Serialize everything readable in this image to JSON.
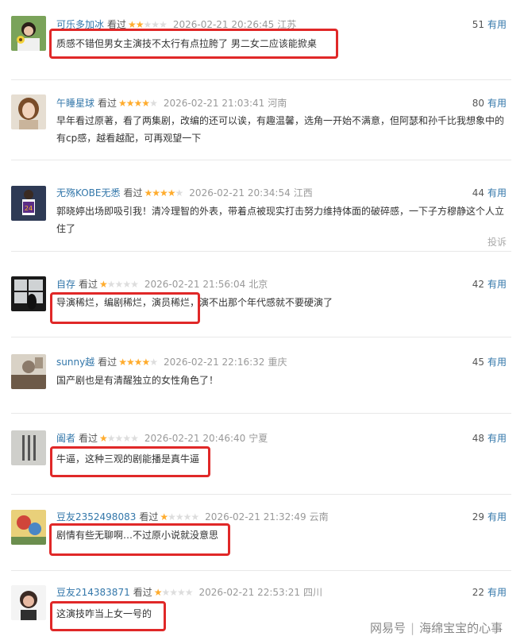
{
  "comments": [
    {
      "user": "可乐多加冰",
      "status": "看过",
      "stars": 2,
      "time": "2026-02-21 20:26:45",
      "location": "江苏",
      "votes": "51",
      "useful": "有用",
      "text": "质感不错但男女主演技不太行有点拉胯了 男二女二应该能掀桌"
    },
    {
      "user": "午睡星球",
      "status": "看过",
      "stars": 4,
      "time": "2026-02-21 21:03:41",
      "location": "河南",
      "votes": "80",
      "useful": "有用",
      "text": "早年看过原著，看了两集剧，改编的还可以诶，有趣温馨，选角一开始不满意，但阿瑟和孙千比我想象中的有cp感，越看越配，可再观望一下"
    },
    {
      "user": "无殇KOBE无悉",
      "status": "看过",
      "stars": 4,
      "time": "2026-02-21 20:34:54",
      "location": "江西",
      "votes": "44",
      "useful": "有用",
      "text": "郭晓婷出场即吸引我！清冷理智的外表，带着点被现实打击努力维持体面的破碎感，一下子方穆静这个人立住了",
      "report": "投诉"
    },
    {
      "user": "自存",
      "status": "看过",
      "stars": 1,
      "time": "2026-02-21 21:56:04",
      "location": "北京",
      "votes": "42",
      "useful": "有用",
      "text": "导演稀烂，编剧稀烂，演员稀烂，演不出那个年代感就不要硬演了"
    },
    {
      "user": "sunny越",
      "status": "看过",
      "stars": 4,
      "time": "2026-02-21 22:16:32",
      "location": "重庆",
      "votes": "45",
      "useful": "有用",
      "text": "国产剧也是有清醒独立的女性角色了！"
    },
    {
      "user": "阖者",
      "status": "看过",
      "stars": 1,
      "time": "2026-02-21 20:46:40",
      "location": "宁夏",
      "votes": "48",
      "useful": "有用",
      "text": "牛逼，这种三观的剧能播是真牛逼"
    },
    {
      "user": "豆友2352498083",
      "status": "看过",
      "stars": 1,
      "time": "2026-02-21 21:32:49",
      "location": "云南",
      "votes": "29",
      "useful": "有用",
      "text": "剧情有些无聊啊…不过原小说就没意思"
    },
    {
      "user": "豆友214383871",
      "status": "看过",
      "stars": 1,
      "time": "2026-02-21 22:53:21",
      "location": "四川",
      "votes": "22",
      "useful": "有用",
      "text": "这演技咋当上女一号的"
    }
  ],
  "watermark": {
    "brand": "网易号",
    "author": "海绵宝宝的心事"
  }
}
